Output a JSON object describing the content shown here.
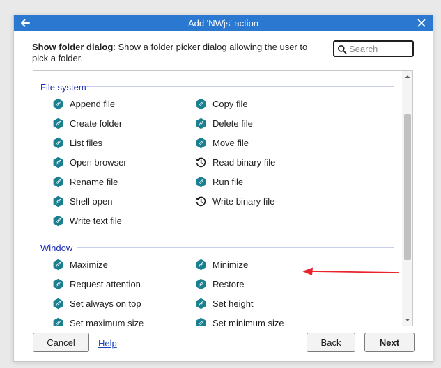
{
  "window": {
    "title": "Add 'NWjs' action",
    "back_icon": "arrow-left-icon",
    "close_icon": "close-icon"
  },
  "description": {
    "action_name": "Show folder dialog",
    "text": ": Show a folder picker dialog allowing the user to pick a folder."
  },
  "search": {
    "placeholder": "Search",
    "value": ""
  },
  "categories": [
    {
      "name": "File system",
      "items": [
        {
          "label": "Append file",
          "icon": "nwjs-icon"
        },
        {
          "label": "Copy file",
          "icon": "nwjs-icon"
        },
        {
          "label": "Create folder",
          "icon": "nwjs-icon"
        },
        {
          "label": "Delete file",
          "icon": "nwjs-icon"
        },
        {
          "label": "List files",
          "icon": "nwjs-icon"
        },
        {
          "label": "Move file",
          "icon": "nwjs-icon"
        },
        {
          "label": "Open browser",
          "icon": "nwjs-icon"
        },
        {
          "label": "Read binary file",
          "icon": "async-clock-icon"
        },
        {
          "label": "Rename file",
          "icon": "nwjs-icon"
        },
        {
          "label": "Run file",
          "icon": "nwjs-icon"
        },
        {
          "label": "Shell open",
          "icon": "nwjs-icon"
        },
        {
          "label": "Write binary file",
          "icon": "async-clock-icon"
        },
        {
          "label": "Write text file",
          "icon": "nwjs-icon"
        }
      ]
    },
    {
      "name": "Window",
      "items": [
        {
          "label": "Maximize",
          "icon": "nwjs-icon"
        },
        {
          "label": "Minimize",
          "icon": "nwjs-icon"
        },
        {
          "label": "Request attention",
          "icon": "nwjs-icon"
        },
        {
          "label": "Restore",
          "icon": "nwjs-icon"
        },
        {
          "label": "Set always on top",
          "icon": "nwjs-icon"
        },
        {
          "label": "Set height",
          "icon": "nwjs-icon"
        },
        {
          "label": "Set maximum size",
          "icon": "nwjs-icon"
        },
        {
          "label": "Set minimum size",
          "icon": "nwjs-icon"
        }
      ]
    }
  ],
  "buttons": {
    "cancel": "Cancel",
    "help": "Help",
    "back": "Back",
    "next": "Next"
  },
  "colors": {
    "titlebar": "#2b78d0",
    "category_text": "#1a2bb5",
    "nwjs_icon": "#1a7f8e",
    "annotation_arrow": "#e8232b",
    "link": "#1a44c4"
  }
}
